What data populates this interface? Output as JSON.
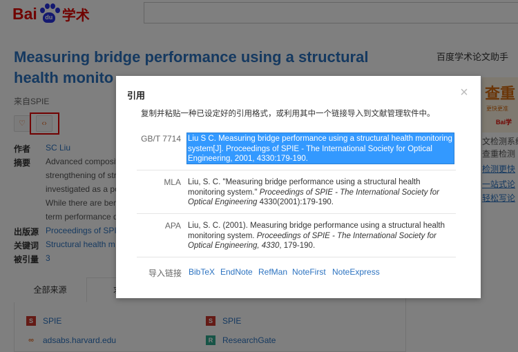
{
  "header": {
    "logo_left": "Bai",
    "logo_paw": "du",
    "logo_right": "学术",
    "search_value": ""
  },
  "paper": {
    "title_line1": "Measuring bridge performance using a structural",
    "title_line2": "health monito",
    "source": "来自SPIE",
    "author_label": "作者",
    "author": "SC Liu",
    "abstract_label": "摘要",
    "abstract_lines": [
      "Advanced composit",
      "strengthening of str",
      "investigated as a po",
      "While there are ber",
      "term performance d"
    ],
    "publisher_label": "出版源",
    "publisher": "Proceedings of SPI",
    "keywords_label": "关键词",
    "keywords": "Structural health m",
    "cited_label": "被引量",
    "cited": "3"
  },
  "right_panel": {
    "title": "百度学术论文助手",
    "ad_big": "查重",
    "ad_small": "更快更准",
    "ad_logo": "Bai学",
    "lines": [
      "文检测系统",
      "查重检测",
      "检测更快",
      "一站式论",
      "轻松写论"
    ]
  },
  "sources": {
    "tab_all": "全部来源",
    "tab_2": "求",
    "items": [
      {
        "name": "SPIE",
        "icon": "spie-icon"
      },
      {
        "name": "adsabs.harvard.edu",
        "icon": "link-icon"
      },
      {
        "name": "SPIE",
        "icon": "spie-icon"
      },
      {
        "name": "ResearchGate",
        "icon": "researchgate-icon"
      }
    ]
  },
  "dialog": {
    "title": "引用",
    "close": "×",
    "description": "复制并粘贴一种已设定好的引用格式，或利用其中一个链接导入到文献管理软件中。",
    "citations": [
      {
        "style": "GB/T 7714",
        "text": "Liu S C. Measuring bridge performance using a structural health monitoring system[J]. Proceedings of SPIE - The International Society for Optical Engineering, 2001, 4330:179-190."
      },
      {
        "style": "MLA",
        "text_plain": "Liu, S. C. \"Measuring bridge performance using a structural health monitoring system.\" ",
        "text_italic": "Proceedings of SPIE - The International Society for Optical Engineering",
        "text_tail": " 4330(2001):179-190."
      },
      {
        "style": "APA",
        "text_plain": "Liu, S. C. (2001). Measuring bridge performance using a structural health monitoring system. ",
        "text_italic": "Proceedings of SPIE - The International Society for Optical Engineering, 4330",
        "text_tail": ", 179-190."
      }
    ],
    "import_label": "导入链接",
    "import_links": [
      "BibTeX",
      "EndNote",
      "RefMan",
      "NoteFirst",
      "NoteExpress"
    ]
  },
  "colors": {
    "link": "#2b72c0",
    "brand_red": "#e10601",
    "brand_blue": "#2932e1",
    "selection": "#3399ff"
  }
}
